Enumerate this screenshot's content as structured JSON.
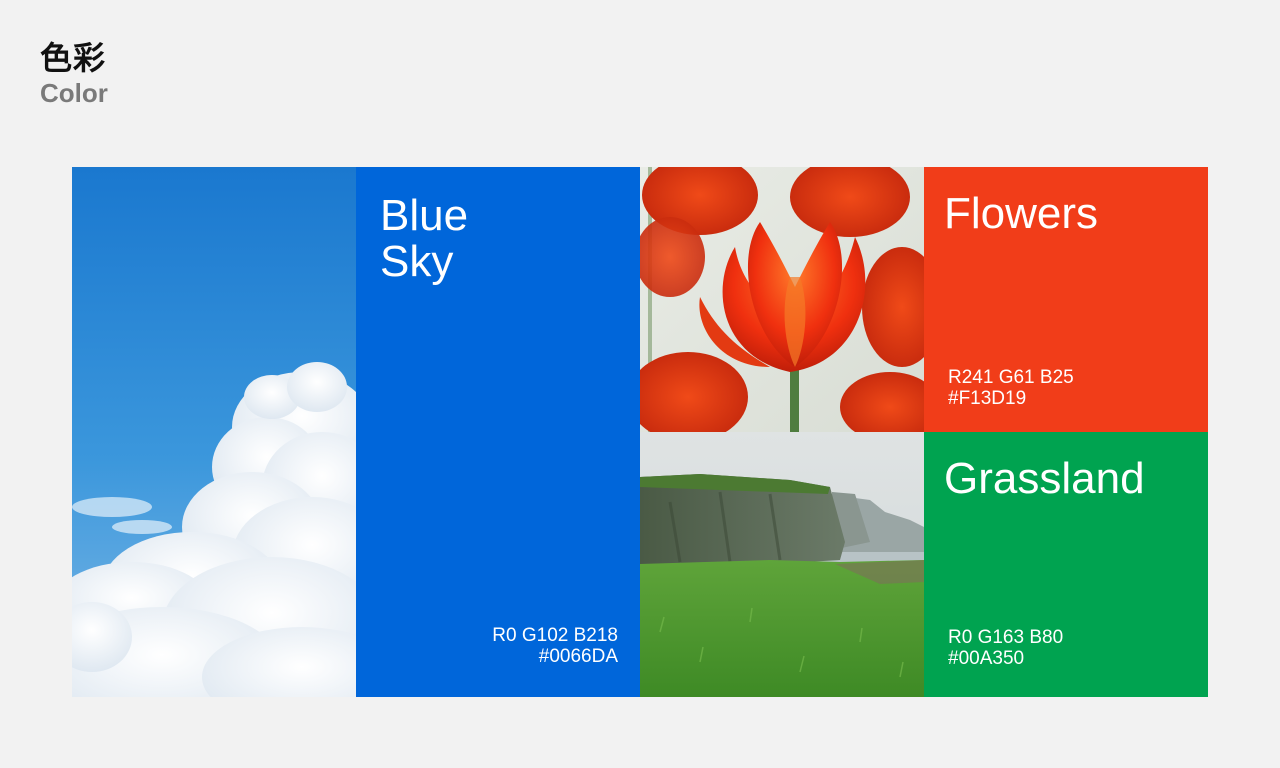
{
  "header": {
    "title_cn": "色彩",
    "title_en": "Color"
  },
  "swatches": {
    "blue_sky": {
      "name": "Blue\nSky",
      "rgb": "R0 G102 B218",
      "hex": "#0066DA",
      "color": "#0066DA"
    },
    "flowers": {
      "name": "Flowers",
      "rgb": "R241 G61 B25",
      "hex": "#F13D19",
      "color": "#F13D19"
    },
    "grassland": {
      "name": "Grassland",
      "rgb": "R0 G163 B80",
      "hex": "#00A350",
      "color": "#00A350"
    }
  },
  "images": {
    "sky": "sky-with-clouds-photo",
    "tulips": "red-tulips-photo",
    "cliffs": "grassy-cliffs-photo"
  }
}
